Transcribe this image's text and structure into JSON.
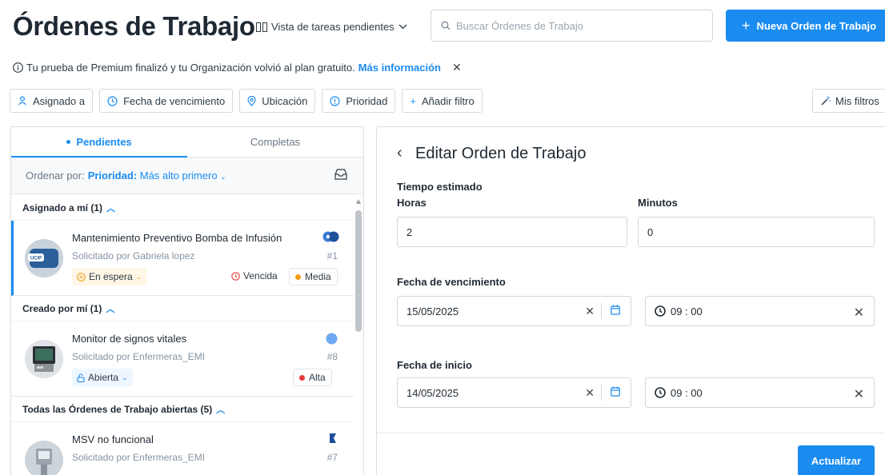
{
  "header": {
    "title": "Órdenes de Trabajo",
    "view_label": "Vista de tareas pendientes",
    "search_placeholder": "Buscar Órdenes de Trabajo",
    "new_button": "Nueva Orden de Trabajo"
  },
  "notice": {
    "text": "Tu prueba de Premium finalizó y tu Organización volvió al plan gratuito.",
    "link": "Más información"
  },
  "filters": [
    {
      "label": "Asignado a",
      "icon": "person-icon"
    },
    {
      "label": "Fecha de vencimiento",
      "icon": "clock-icon"
    },
    {
      "label": "Ubicación",
      "icon": "location-pin-icon"
    },
    {
      "label": "Prioridad",
      "icon": "priority-icon"
    },
    {
      "label": "Añadir filtro",
      "icon": "plus-icon"
    }
  ],
  "my_filters": "Mis filtros",
  "left": {
    "tabs": [
      "Pendientes",
      "Completas"
    ],
    "sort_prefix": "Ordenar por:",
    "sort_field": "Prioridad:",
    "sort_value": "Más alto primero",
    "groups": [
      {
        "title": "Asignado a mí (1)",
        "items": [
          {
            "title": "Mantenimiento Preventivo Bomba de Infusión",
            "sub": "Solicitado por Gabriela lopez",
            "num": "#1",
            "status": "En espera",
            "overdue": "Vencida",
            "priority": "Media",
            "priority_color": "#f39c12",
            "avatar_label": "UCIP"
          }
        ]
      },
      {
        "title": "Creado por mí (1)",
        "items": [
          {
            "title": "Monitor de signos vitales",
            "sub": "Solicitado por Enfermeras_EMI",
            "num": "#8",
            "status": "Abierta",
            "priority": "Alta",
            "priority_color": "#e53935"
          }
        ]
      },
      {
        "title": "Todas las Órdenes de Trabajo abiertas (5)",
        "items": [
          {
            "title": "MSV no funcional",
            "sub": "Solicitado por Enfermeras_EMI",
            "num": "#7"
          }
        ]
      }
    ]
  },
  "edit": {
    "title": "Editar Orden de Trabajo",
    "estimated_label": "Tiempo estimado",
    "hours_label": "Horas",
    "hours_value": "2",
    "minutes_label": "Minutos",
    "minutes_value": "0",
    "due_label": "Fecha de vencimiento",
    "due_date": "15/05/2025",
    "due_time": "09 : 00",
    "start_label": "Fecha de inicio",
    "start_date": "14/05/2025",
    "start_time": "09 : 00",
    "update_button": "Actualizar"
  },
  "colors": {
    "accent": "#1a8cf0",
    "high": "#e53935",
    "medium": "#f39c12"
  }
}
